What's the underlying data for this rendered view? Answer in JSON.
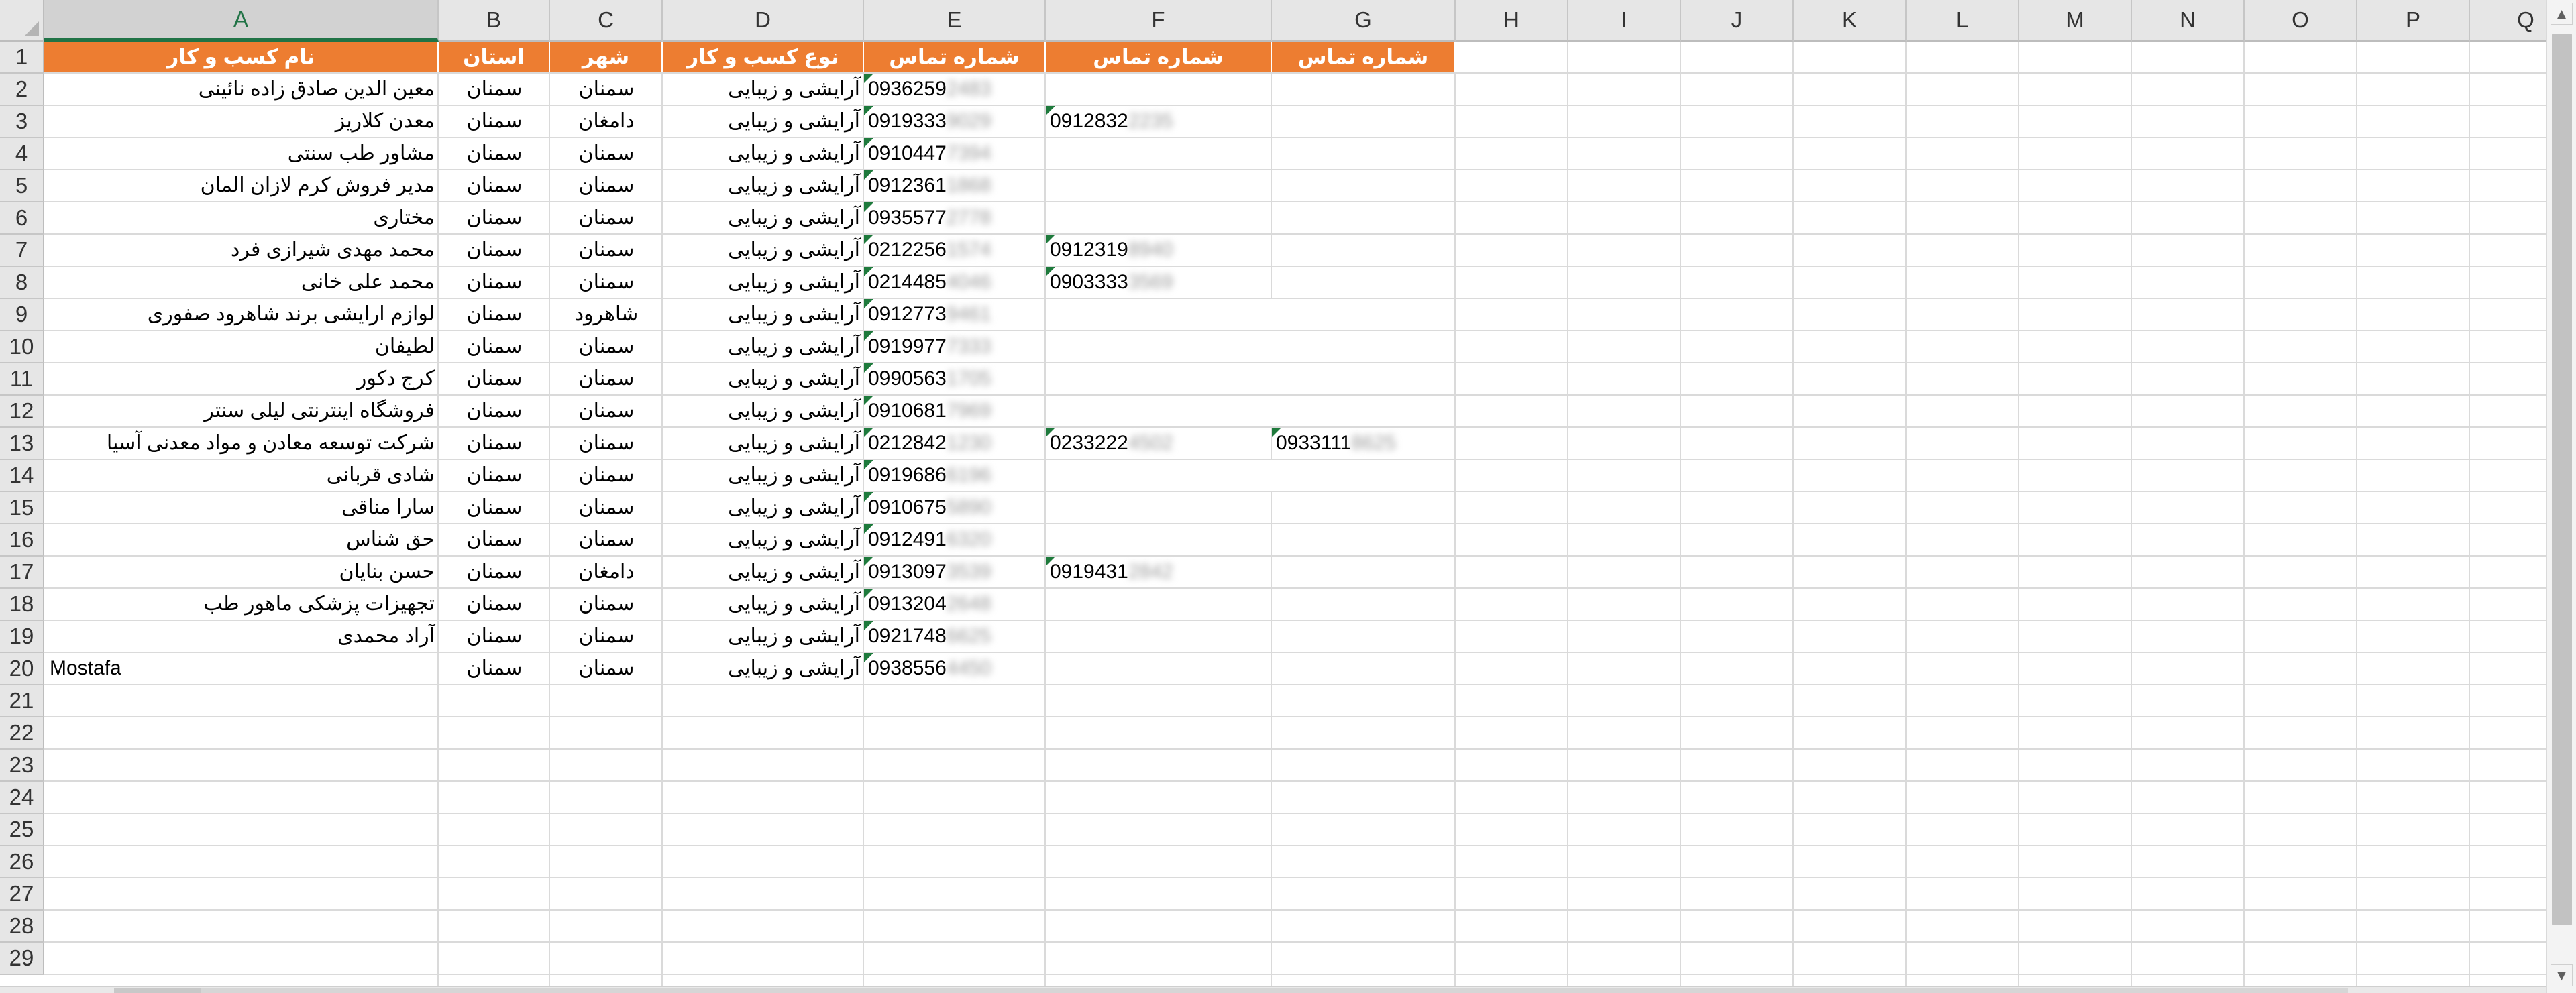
{
  "columns": [
    "A",
    "B",
    "C",
    "D",
    "E",
    "F",
    "G",
    "H",
    "I",
    "J",
    "K",
    "L",
    "M",
    "N",
    "O",
    "P",
    "Q"
  ],
  "selected_column": "A",
  "row_numbers": [
    "1",
    "2",
    "3",
    "4",
    "5",
    "6",
    "7",
    "8",
    "9",
    "10",
    "11",
    "12",
    "13",
    "14",
    "15",
    "16",
    "17",
    "18",
    "19",
    "20",
    "21",
    "22",
    "23",
    "24",
    "25",
    "26",
    "27",
    "28",
    "29"
  ],
  "header_row": {
    "A": "نام کسب و کار",
    "B": "استان",
    "C": "شهر",
    "D": "نوع کسب و کار",
    "E": "شماره تماس",
    "F": "شماره تماس",
    "G": "شماره تماس"
  },
  "header_color": "#ed7d31",
  "rows": [
    {
      "name": "معین الدین صادق زاده نائینی",
      "province": "سمنان",
      "city": "سمنان",
      "type": "آرایشی و زیبایی",
      "phone1": "0936259",
      "phone1_blur": "2483",
      "phone2": "",
      "phone2_blur": "",
      "phone3": "",
      "phone3_blur": ""
    },
    {
      "name": "معدن کلاریز",
      "province": "سمنان",
      "city": "دامغان",
      "type": "آرایشی و زیبایی",
      "phone1": "0919333",
      "phone1_blur": "9029",
      "phone2": "0912832",
      "phone2_blur": "2235",
      "phone3": "",
      "phone3_blur": ""
    },
    {
      "name": "مشاور طب سنتی",
      "province": "سمنان",
      "city": "سمنان",
      "type": "آرایشی و زیبایی",
      "phone1": "0910447",
      "phone1_blur": "7394",
      "phone2": "",
      "phone2_blur": "",
      "phone3": "",
      "phone3_blur": ""
    },
    {
      "name": "مدیر فروش کرم لازان المان",
      "province": "سمنان",
      "city": "سمنان",
      "type": "آرایشی و زیبایی",
      "phone1": "0912361",
      "phone1_blur": "1868",
      "phone2": "",
      "phone2_blur": "",
      "phone3": "",
      "phone3_blur": ""
    },
    {
      "name": "مختاری",
      "province": "سمنان",
      "city": "سمنان",
      "type": "آرایشی و زیبایی",
      "phone1": "0935577",
      "phone1_blur": "2778",
      "phone2": "",
      "phone2_blur": "",
      "phone3": "",
      "phone3_blur": ""
    },
    {
      "name": "محمد مهدی شیرازی فرد",
      "province": "سمنان",
      "city": "سمنان",
      "type": "آرایشی و زیبایی",
      "phone1": "0212256",
      "phone1_blur": "1574",
      "phone2": "0912319",
      "phone2_blur": "8940",
      "phone3": "",
      "phone3_blur": ""
    },
    {
      "name": "محمد علی خانی",
      "province": "سمنان",
      "city": "سمنان",
      "type": "آرایشی و زیبایی",
      "phone1": "0214485",
      "phone1_blur": "4046",
      "phone2": "0903333",
      "phone2_blur": "3569",
      "phone3": "",
      "phone3_blur": ""
    },
    {
      "name": "لوازم ارایشی برند شاهرود صفوری",
      "province": "سمنان",
      "city": "شاهرود",
      "type": "آرایشی و زیبایی",
      "phone1": "0912773",
      "phone1_blur": "9461",
      "phone2": "",
      "phone2_blur": "",
      "phone3": "",
      "phone3_blur": ""
    },
    {
      "name": "لطیفان",
      "province": "سمنان",
      "city": "سمنان",
      "type": "آرایشی و زیبایی",
      "phone1": "0919977",
      "phone1_blur": "7333",
      "phone2": "",
      "phone2_blur": "",
      "phone3": "",
      "phone3_blur": ""
    },
    {
      "name": "کرج دکور",
      "province": "سمنان",
      "city": "سمنان",
      "type": "آرایشی و زیبایی",
      "phone1": "0990563",
      "phone1_blur": "1705",
      "phone2": "",
      "phone2_blur": "",
      "phone3": "",
      "phone3_blur": ""
    },
    {
      "name": "فروشگاه اینترنتی لیلی سنتر",
      "province": "سمنان",
      "city": "سمنان",
      "type": "آرایشی و زیبایی",
      "phone1": "0910681",
      "phone1_blur": "7969",
      "phone2": "",
      "phone2_blur": "",
      "phone3": "",
      "phone3_blur": ""
    },
    {
      "name": "شرکت توسعه معادن و مواد معدنی آسیا",
      "province": "سمنان",
      "city": "سمنان",
      "type": "آرایشی و زیبایی",
      "phone1": "0212842",
      "phone1_blur": "1230",
      "phone2": "0233222",
      "phone2_blur": "4502",
      "phone3": "0933111",
      "phone3_blur": "8625"
    },
    {
      "name": "شادی قربانی",
      "province": "سمنان",
      "city": "سمنان",
      "type": "آرایشی و زیبایی",
      "phone1": "0919686",
      "phone1_blur": "6196",
      "phone2": "",
      "phone2_blur": "",
      "phone3": "",
      "phone3_blur": ""
    },
    {
      "name": "سارا مناقی",
      "province": "سمنان",
      "city": "سمنان",
      "type": "آرایشی و زیبایی",
      "phone1": "0910675",
      "phone1_blur": "5890",
      "phone2": "",
      "phone2_blur": "",
      "phone3": "",
      "phone3_blur": ""
    },
    {
      "name": "حق شناس",
      "province": "سمنان",
      "city": "سمنان",
      "type": "آرایشی و زیبایی",
      "phone1": "0912491",
      "phone1_blur": "6320",
      "phone2": "",
      "phone2_blur": "",
      "phone3": "",
      "phone3_blur": ""
    },
    {
      "name": "حسن بنایان",
      "province": "سمنان",
      "city": "دامغان",
      "type": "آرایشی و زیبایی",
      "phone1": "0913097",
      "phone1_blur": "3539",
      "phone2": "0919431",
      "phone2_blur": "2842",
      "phone3": "",
      "phone3_blur": ""
    },
    {
      "name": "تجهیزات پزشکی ماهور طب",
      "province": "سمنان",
      "city": "سمنان",
      "type": "آرایشی و زیبایی",
      "phone1": "0913204",
      "phone1_blur": "2648",
      "phone2": "",
      "phone2_blur": "",
      "phone3": "",
      "phone3_blur": ""
    },
    {
      "name": "آراد محمدی",
      "province": "سمنان",
      "city": "سمنان",
      "type": "آرایشی و زیبایی",
      "phone1": "0921748",
      "phone1_blur": "6625",
      "phone2": "",
      "phone2_blur": "",
      "phone3": "",
      "phone3_blur": ""
    },
    {
      "name": "Mostafa",
      "name_ltr": true,
      "province": "سمنان",
      "city": "سمنان",
      "type": "آرایشی و زیبایی",
      "phone1": "0938556",
      "phone1_blur": "4450",
      "phone2": "",
      "phone2_blur": "",
      "phone3": "",
      "phone3_blur": ""
    }
  ],
  "icons": {
    "scroll_up": "scroll-up-arrow-icon",
    "scroll_down": "scroll-down-arrow-icon",
    "select_all": "select-all-triangle-icon",
    "error_marker": "green-triangle-indicator-icon"
  },
  "colors": {
    "selected_header_accent": "#217346",
    "error_marker": "#1e7a3c"
  }
}
